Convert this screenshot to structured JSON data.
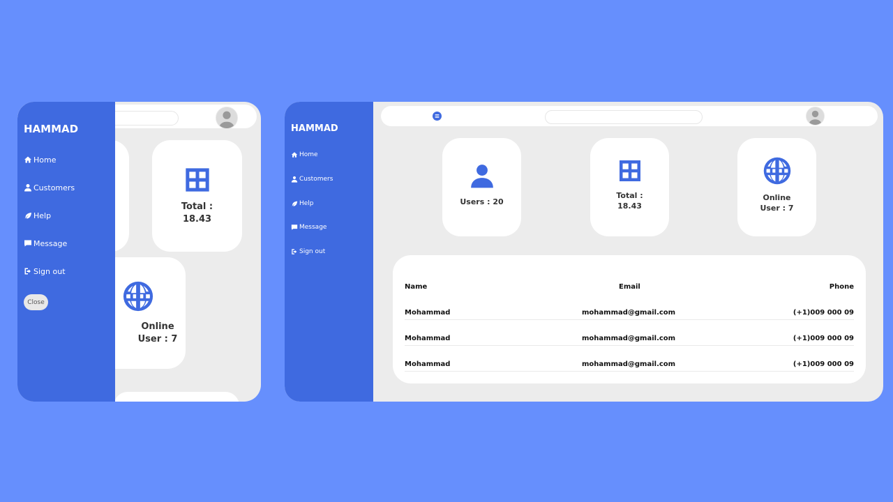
{
  "sidebar": {
    "brand": "HAMMAD",
    "items": [
      {
        "label": "Home",
        "icon": "home-icon"
      },
      {
        "label": "Customers",
        "icon": "user-icon"
      },
      {
        "label": "Help",
        "icon": "leaf-icon"
      },
      {
        "label": "Message",
        "icon": "message-icon"
      },
      {
        "label": "Sign out",
        "icon": "sign-out-icon"
      }
    ],
    "close_label": "Close"
  },
  "cards": {
    "users": "Users : 20",
    "total_line1": "Total :",
    "total_line2": "18.43",
    "online_line1": "Online",
    "online_line2": "User : 7"
  },
  "table": {
    "headers": {
      "name": "Name",
      "email": "Email",
      "phone": "Phone"
    },
    "rows": [
      {
        "name": "Mohammad",
        "email": "mohammad@gmail.com",
        "phone": "(+1)009 000 09"
      },
      {
        "name": "Mohammad",
        "email": "mohammad@gmail.com",
        "phone": "(+1)009 000 09"
      },
      {
        "name": "Mohammad",
        "email": "mohammad@gmail.com",
        "phone": "(+1)009 000 09"
      }
    ]
  },
  "colors": {
    "background": "#668ffd",
    "sidebar": "#3f6ae0",
    "panel": "#ececec",
    "card": "#ffffff",
    "icon": "#3f6ae0"
  }
}
